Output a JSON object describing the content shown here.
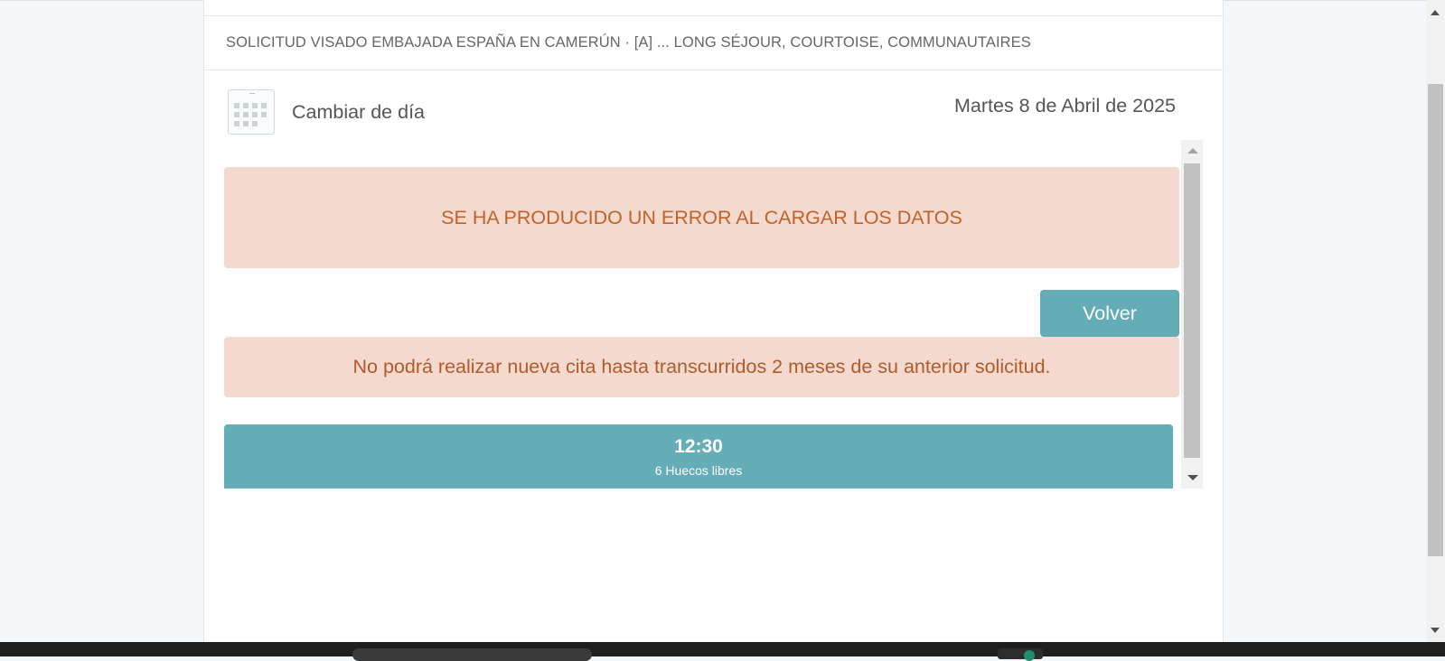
{
  "service": {
    "title": "SOLICITUD VISADO EMBAJADA ESPAÑA EN CAMERÚN · [A] ... LONG SÉJOUR, COURTOISE, COMMUNAUTAIRES"
  },
  "calendar": {
    "change_day_label": "Cambiar de día",
    "icon": "calendar-icon",
    "selected_date": "Martes 8 de Abril de 2025"
  },
  "alerts": {
    "error": "SE HA PRODUCIDO UN ERROR AL CARGAR LOS DATOS",
    "warning": "No podrá realizar nueva cita hasta transcurridos 2 meses de su anterior solicitud."
  },
  "buttons": {
    "back_label": "Volver"
  },
  "slots": [
    {
      "time": "12:30",
      "availability": "6 Huecos libres"
    }
  ],
  "colors": {
    "accent": "#64adb7",
    "alert_background": "#f3d9ce",
    "alert_text": "#c0622a",
    "page_background": "#f5f8fb"
  }
}
